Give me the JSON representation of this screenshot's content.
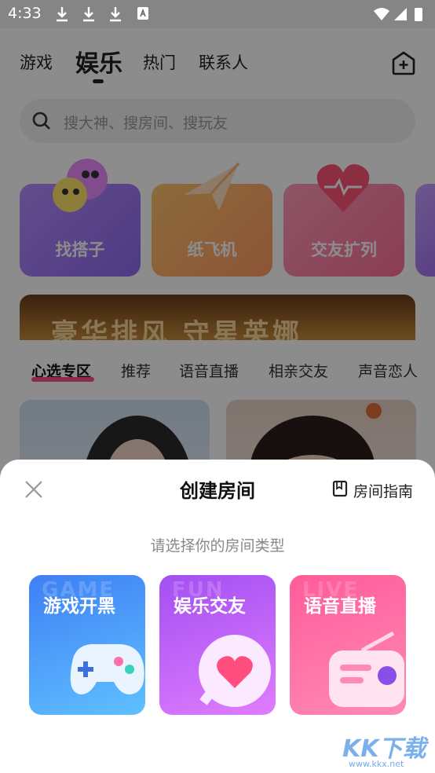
{
  "status_bar": {
    "time": "4:33"
  },
  "nav": {
    "tabs": [
      {
        "label": "游戏"
      },
      {
        "label": "娱乐"
      },
      {
        "label": "热门"
      },
      {
        "label": "联系人"
      }
    ]
  },
  "search": {
    "placeholder": "搜大神、搜房间、搜玩友"
  },
  "feature_cards": [
    {
      "label": "找搭子"
    },
    {
      "label": "纸飞机"
    },
    {
      "label": "交友扩列"
    }
  ],
  "banner": {
    "text": "豪华排风 守星英娜"
  },
  "sub_tabs": [
    {
      "label": "心选专区"
    },
    {
      "label": "推荐"
    },
    {
      "label": "语音直播"
    },
    {
      "label": "相亲交友"
    },
    {
      "label": "声音恋人"
    }
  ],
  "sheet": {
    "title": "创建房间",
    "guide_label": "房间指南",
    "prompt": "请选择你的房间类型",
    "types": [
      {
        "label": "游戏开黑",
        "bg_word": "GAME"
      },
      {
        "label": "娱乐交友",
        "bg_word": "FUN"
      },
      {
        "label": "语音直播",
        "bg_word": "LIVE"
      }
    ]
  },
  "watermark": {
    "text": "KK下载",
    "url": "www.kkx.net"
  },
  "colors": {
    "accent": "#ff4f8b",
    "game": "#3f8cf7",
    "fun": "#b14cf2",
    "live": "#ff4a8e"
  }
}
